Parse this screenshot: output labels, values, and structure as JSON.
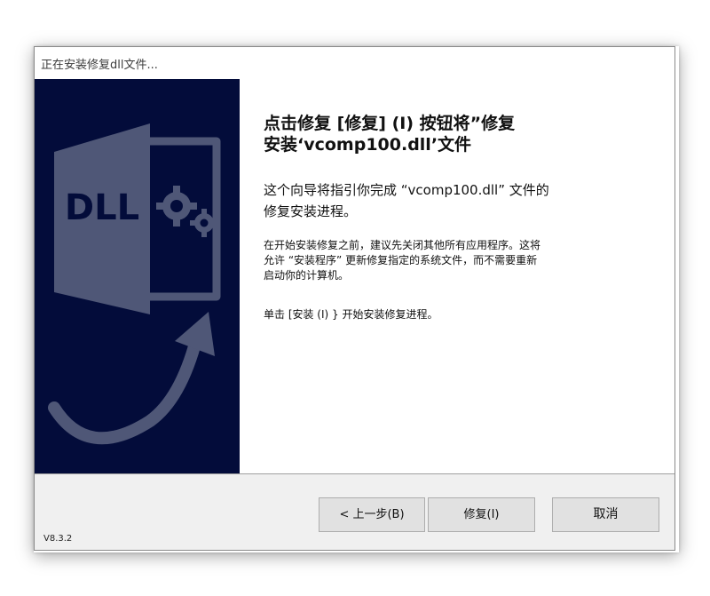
{
  "window": {
    "title": "正在安装修复dll文件..."
  },
  "sidebar": {
    "file_icon_label": "DLL",
    "accent_color": "#030c3a"
  },
  "content": {
    "heading_line1": "点击修复 [修复] (I) 按钮将”修复",
    "heading_line2": "安装‘vcomp100.dll’文件",
    "intro_line1": "这个向导将指引你完成 “vcomp100.dll” 文件的",
    "intro_line2": "修复安装进程。",
    "warning_line1": "在开始安装修复之前，建议先关闭其他所有应用程序。这将",
    "warning_line2": "允许 “安装程序” 更新修复指定的系统文件，而不需要重新",
    "warning_line3": "启动你的计算机。",
    "click_note": "单击 [安装 (I) } 开始安装修复进程。"
  },
  "footer": {
    "version": "V8.3.2",
    "back_label": "< 上一步(B)",
    "repair_label": "修复(I)",
    "cancel_label": "取消"
  }
}
